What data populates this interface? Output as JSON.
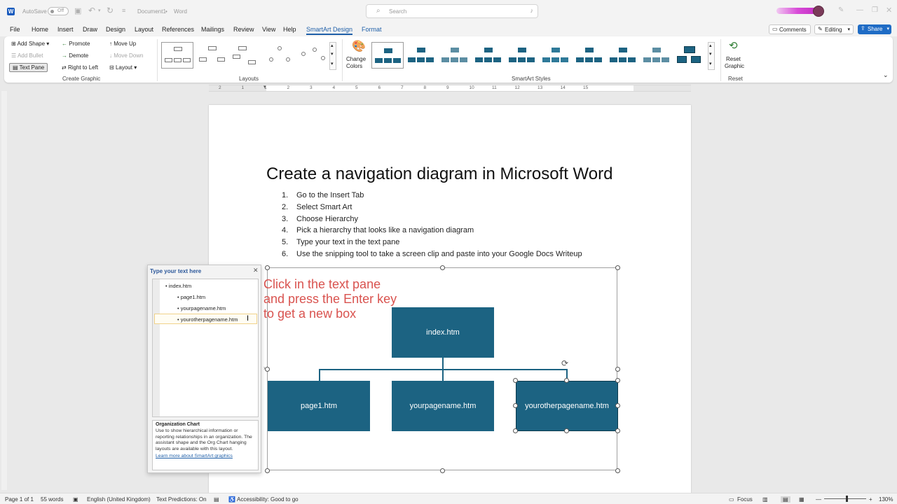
{
  "titlebar": {
    "autosave": "AutoSave",
    "autosave_state": "Off",
    "document": "Document1",
    "app": "Word",
    "search_placeholder": "Search"
  },
  "tabs": [
    "File",
    "Home",
    "Insert",
    "Draw",
    "Design",
    "Layout",
    "References",
    "Mailings",
    "Review",
    "View",
    "Help",
    "SmartArt Design",
    "Format"
  ],
  "ribbon_right": {
    "comments": "Comments",
    "editing": "Editing",
    "share": "Share"
  },
  "create_graphic": {
    "add_shape": "Add Shape",
    "add_bullet": "Add Bullet",
    "text_pane": "Text Pane",
    "promote": "Promote",
    "demote": "Demote",
    "rtl": "Right to Left",
    "move_up": "Move Up",
    "move_down": "Move Down",
    "layout": "Layout",
    "label": "Create Graphic"
  },
  "groups": {
    "layouts": "Layouts",
    "change_colors_1": "Change",
    "change_colors_2": "Colors",
    "styles": "SmartArt Styles",
    "reset_1": "Reset",
    "reset_2": "Graphic",
    "reset_label": "Reset"
  },
  "ruler_numbers": [
    "2",
    "1",
    "1",
    "2",
    "3",
    "4",
    "5",
    "6",
    "7",
    "8",
    "9",
    "10",
    "11",
    "12",
    "13",
    "14",
    "15"
  ],
  "document": {
    "title": "Create a navigation diagram in Microsoft Word",
    "steps": [
      {
        "n": "1.",
        "text": "Go to the Insert Tab"
      },
      {
        "n": "2.",
        "text": "Select Smart Art"
      },
      {
        "n": "3.",
        "text": "Choose Hierarchy"
      },
      {
        "n": "4.",
        "text": "Pick a hierarchy that looks like a navigation diagram"
      },
      {
        "n": "5.",
        "text": "Type your text in the text pane"
      },
      {
        "n": "6.",
        "text": "Use the snipping tool to take a screen clip and paste into your Google Docs Writeup"
      }
    ]
  },
  "text_pane": {
    "header": "Type your text here",
    "items": [
      "index.htm",
      "page1.htm",
      "yourpagename.htm",
      "yourotherpagename.htm"
    ],
    "desc_title": "Organization Chart",
    "desc_body": "Use to show hierarchical information or reporting relationships in an organization. The assistant shape and the Org Chart hanging layouts are available with this layout.",
    "learn_more": "Learn more about SmartArt graphics"
  },
  "callout": "Click in the text pane and press the Enter key to get a new box",
  "diagram": {
    "root": "index.htm",
    "children": [
      "page1.htm",
      "yourpagename.htm",
      "yourotherpagename.htm"
    ]
  },
  "status": {
    "page": "Page 1 of 1",
    "words": "55 words",
    "language": "English (United Kingdom)",
    "predictions": "Text Predictions: On",
    "accessibility": "Accessibility: Good to go",
    "focus": "Focus",
    "zoom": "130%"
  },
  "colors": {
    "accent": "#1f5fa8",
    "node": "#1c6382",
    "callout": "#d9534f"
  }
}
